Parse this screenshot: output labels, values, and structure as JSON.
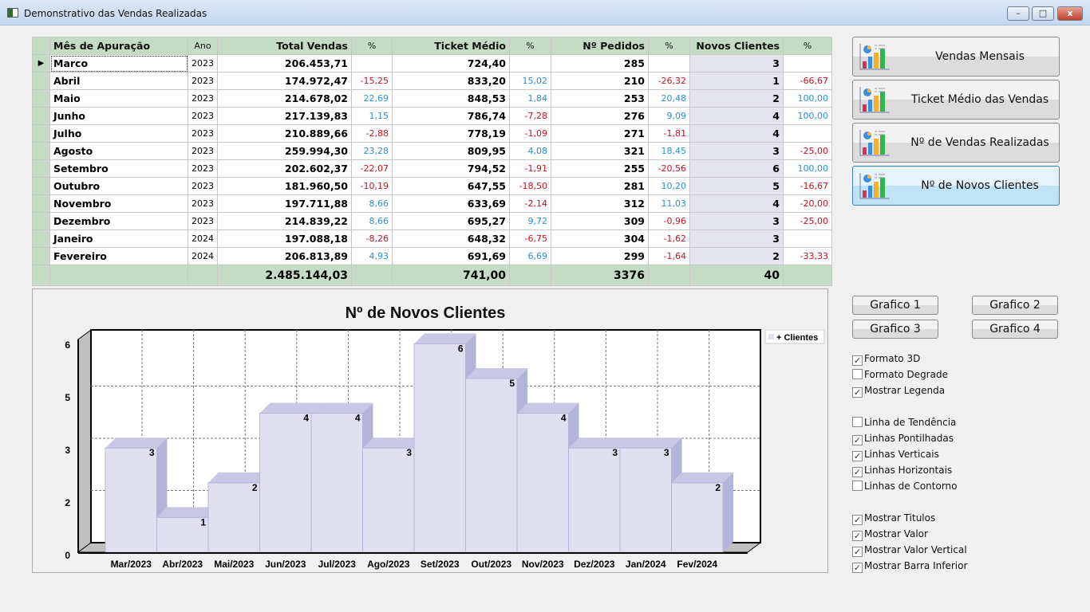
{
  "window": {
    "title": "Demonstrativo das Vendas Realizadas",
    "min": "–",
    "max": "□",
    "close": "x"
  },
  "table": {
    "headers": [
      "Mês de Apuração",
      "Ano",
      "Total Vendas",
      "%",
      "Ticket Médio",
      "%",
      "Nº Pedidos",
      "%",
      "Novos Clientes",
      "%"
    ],
    "rows": [
      [
        "Marco",
        "2023",
        "206.453,71",
        "",
        "724,40",
        "",
        "285",
        "",
        "3",
        ""
      ],
      [
        "Abril",
        "2023",
        "174.972,47",
        "-15,25",
        "833,20",
        "15,02",
        "210",
        "-26,32",
        "1",
        "-66,67"
      ],
      [
        "Maio",
        "2023",
        "214.678,02",
        "22,69",
        "848,53",
        "1,84",
        "253",
        "20,48",
        "2",
        "100,00"
      ],
      [
        "Junho",
        "2023",
        "217.139,83",
        "1,15",
        "786,74",
        "-7,28",
        "276",
        "9,09",
        "4",
        "100,00"
      ],
      [
        "Julho",
        "2023",
        "210.889,66",
        "-2,88",
        "778,19",
        "-1,09",
        "271",
        "-1,81",
        "4",
        ""
      ],
      [
        "Agosto",
        "2023",
        "259.994,30",
        "23,28",
        "809,95",
        "4,08",
        "321",
        "18,45",
        "3",
        "-25,00"
      ],
      [
        "Setembro",
        "2023",
        "202.602,37",
        "-22,07",
        "794,52",
        "-1,91",
        "255",
        "-20,56",
        "6",
        "100,00"
      ],
      [
        "Outubro",
        "2023",
        "181.960,50",
        "-10,19",
        "647,55",
        "-18,50",
        "281",
        "10,20",
        "5",
        "-16,67"
      ],
      [
        "Novembro",
        "2023",
        "197.711,88",
        "8,66",
        "633,69",
        "-2,14",
        "312",
        "11,03",
        "4",
        "-20,00"
      ],
      [
        "Dezembro",
        "2023",
        "214.839,22",
        "8,66",
        "695,27",
        "9,72",
        "309",
        "-0,96",
        "3",
        "-25,00"
      ],
      [
        "Janeiro",
        "2024",
        "197.088,18",
        "-8,26",
        "648,32",
        "-6,75",
        "304",
        "-1,62",
        "3",
        ""
      ],
      [
        "Fevereiro",
        "2024",
        "206.813,89",
        "4,93",
        "691,69",
        "6,69",
        "299",
        "-1,64",
        "2",
        "-33,33"
      ]
    ],
    "totals": {
      "total_vendas": "2.485.144,03",
      "ticket": "741,00",
      "pedidos": "3376",
      "novos": "40"
    }
  },
  "buttons": {
    "vendas": "Vendas Mensais",
    "ticket": "Ticket Médio das Vendas",
    "pedidos": "Nº de Vendas Realizadas",
    "novos": "Nº de Novos Clientes"
  },
  "grafico": [
    "Grafico 1",
    "Grafico 2",
    "Grafico 3",
    "Grafico 4"
  ],
  "options": [
    {
      "label": "Formato 3D",
      "checked": true
    },
    {
      "label": "Formato Degrade",
      "checked": false
    },
    {
      "label": "Mostrar Legenda",
      "checked": true
    },
    {
      "label": "Linha de Tendência",
      "checked": false
    },
    {
      "label": "Linhas Pontilhadas",
      "checked": true
    },
    {
      "label": "Linhas Verticais",
      "checked": true
    },
    {
      "label": "Linhas Horizontais",
      "checked": true
    },
    {
      "label": "Linhas de Contorno",
      "checked": false
    },
    {
      "label": "Mostrar Titulos",
      "checked": true
    },
    {
      "label": "Mostrar Valor",
      "checked": true
    },
    {
      "label": "Mostrar Valor Vertical",
      "checked": true
    },
    {
      "label": "Mostrar Barra Inferior",
      "checked": true
    }
  ],
  "chart_data": {
    "type": "bar",
    "title": "Nº de Novos Clientes",
    "legend": "+ Clientes",
    "legend_position": "top-right",
    "categories": [
      "Mar/2023",
      "Abr/2023",
      "Mai/2023",
      "Jun/2023",
      "Jul/2023",
      "Ago/2023",
      "Set/2023",
      "Out/2023",
      "Nov/2023",
      "Dez/2023",
      "Jan/2024",
      "Fev/2024"
    ],
    "values": [
      3,
      1,
      2,
      4,
      4,
      3,
      6,
      5,
      4,
      3,
      3,
      2
    ],
    "ylim": [
      0,
      6
    ],
    "yticks": [
      "0",
      "2",
      "3",
      "5",
      "6"
    ],
    "grid": true,
    "bar_color": "#e0e0f0",
    "side_color": "#b4b4d8",
    "top_color": "#c8c8e4"
  }
}
